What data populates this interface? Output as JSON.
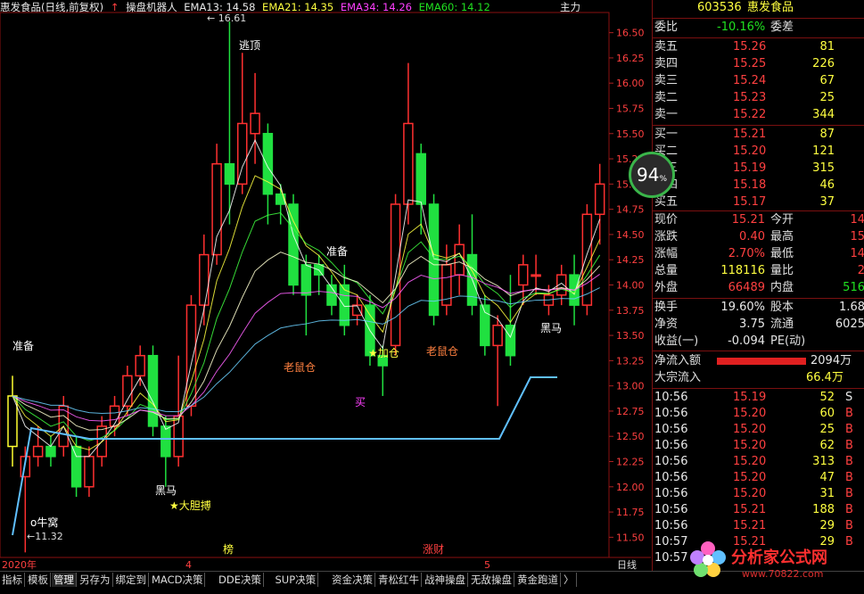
{
  "header": {
    "title": "惠发食品(日线,前复权)",
    "robot": "操盘机器人",
    "ema13": "EMA13: 14.58",
    "ema21": "EMA21: 14.35",
    "ema34": "EMA34: 14.26",
    "ema60": "EMA60: 14.12",
    "right_label": "主力"
  },
  "chart": {
    "y_ticks": [
      "16.50",
      "16.25",
      "16.00",
      "15.75",
      "15.50",
      "15.25",
      "15.00",
      "14.75",
      "14.50",
      "14.25",
      "14.00",
      "13.75",
      "13.50",
      "13.25",
      "13.00",
      "12.75",
      "12.50",
      "12.25",
      "12.00",
      "11.75",
      "11.50"
    ],
    "x_labels": [
      "2020年",
      "4",
      "5",
      "日线"
    ],
    "high_label": "16.61",
    "low_label": "11.32",
    "annotations": [
      {
        "text": "逃顶",
        "color": "#ffffff"
      },
      {
        "text": "准备",
        "color": "#ffffff"
      },
      {
        "text": "准备",
        "color": "#ffffff"
      },
      {
        "text": "老鼠仓",
        "color": "#ff8040"
      },
      {
        "text": "老鼠仓",
        "color": "#ff8040"
      },
      {
        "text": "★加仓",
        "color": "#ffff40"
      },
      {
        "text": "买",
        "color": "#ff40ff"
      },
      {
        "text": "黑马",
        "color": "#ffffff"
      },
      {
        "text": "黑马",
        "color": "#ffffff"
      },
      {
        "text": "★大胆搏",
        "color": "#ffff40"
      },
      {
        "text": "o牛窝",
        "color": "#ffffff"
      },
      {
        "text": "榜",
        "color": "#ffff40"
      },
      {
        "text": "涨财",
        "color": "#ff4040"
      }
    ]
  },
  "chart_data": {
    "type": "candlestick",
    "ylim": [
      11.3,
      16.7
    ],
    "candles": [
      [
        12.4,
        12.9,
        12.2,
        13.1
      ],
      [
        12.1,
        12.3,
        11.35,
        12.4
      ],
      [
        12.3,
        12.4,
        12.2,
        12.6
      ],
      [
        12.4,
        12.3,
        12.2,
        12.5
      ],
      [
        12.4,
        12.8,
        12.3,
        12.9
      ],
      [
        12.4,
        12.0,
        11.9,
        12.5
      ],
      [
        12.0,
        12.3,
        11.9,
        12.4
      ],
      [
        12.3,
        12.6,
        12.2,
        12.7
      ],
      [
        12.6,
        12.8,
        12.5,
        12.9
      ],
      [
        12.8,
        13.1,
        12.7,
        13.2
      ],
      [
        13.1,
        13.3,
        13.0,
        13.4
      ],
      [
        13.3,
        12.6,
        12.5,
        13.4
      ],
      [
        12.6,
        12.3,
        12.0,
        12.7
      ],
      [
        12.3,
        12.7,
        12.2,
        13.3
      ],
      [
        12.8,
        13.8,
        12.7,
        13.9
      ],
      [
        13.8,
        14.3,
        13.6,
        14.5
      ],
      [
        14.3,
        15.2,
        14.2,
        15.4
      ],
      [
        15.2,
        15.0,
        14.6,
        16.61
      ],
      [
        15.0,
        15.6,
        14.9,
        16.3
      ],
      [
        15.5,
        15.7,
        15.2,
        16.1
      ],
      [
        15.5,
        14.9,
        14.6,
        15.6
      ],
      [
        14.9,
        14.8,
        14.6,
        15.0
      ],
      [
        14.8,
        14.0,
        13.9,
        14.9
      ],
      [
        14.2,
        13.9,
        13.5,
        14.3
      ],
      [
        14.2,
        14.1,
        13.9,
        14.3
      ],
      [
        14.0,
        13.8,
        13.7,
        14.1
      ],
      [
        14.0,
        13.6,
        13.5,
        14.2
      ],
      [
        13.7,
        13.8,
        13.6,
        13.9
      ],
      [
        13.8,
        13.3,
        13.2,
        13.9
      ],
      [
        13.3,
        13.2,
        12.9,
        13.4
      ],
      [
        13.4,
        14.8,
        13.3,
        14.9
      ],
      [
        14.8,
        15.6,
        14.6,
        16.2
      ],
      [
        15.3,
        14.8,
        14.5,
        15.4
      ],
      [
        14.8,
        13.7,
        13.6,
        14.9
      ],
      [
        13.8,
        14.2,
        13.7,
        14.4
      ],
      [
        14.1,
        14.4,
        13.9,
        14.6
      ],
      [
        14.3,
        13.8,
        13.7,
        14.7
      ],
      [
        13.8,
        13.4,
        13.3,
        13.9
      ],
      [
        13.4,
        13.6,
        12.8,
        13.7
      ],
      [
        13.6,
        13.3,
        13.2,
        14.1
      ],
      [
        14.0,
        14.2,
        13.8,
        14.3
      ],
      [
        14.1,
        14.1,
        13.9,
        14.3
      ],
      [
        13.8,
        13.9,
        13.7,
        14.0
      ],
      [
        13.9,
        14.1,
        13.8,
        14.2
      ],
      [
        14.1,
        13.8,
        13.6,
        14.3
      ],
      [
        13.8,
        14.7,
        13.7,
        14.8
      ],
      [
        14.7,
        15.0,
        14.4,
        15.2
      ]
    ]
  },
  "quote": {
    "code": "603536",
    "name": "惠发食品",
    "weibi_label": "委比",
    "weibi": "-10.16%",
    "weicha_label": "委差",
    "asks": [
      {
        "label": "卖五",
        "price": "15.26",
        "vol": "81"
      },
      {
        "label": "卖四",
        "price": "15.25",
        "vol": "226"
      },
      {
        "label": "卖三",
        "price": "15.24",
        "vol": "67"
      },
      {
        "label": "卖二",
        "price": "15.23",
        "vol": "25"
      },
      {
        "label": "卖一",
        "price": "15.22",
        "vol": "344"
      }
    ],
    "bids": [
      {
        "label": "买一",
        "price": "15.21",
        "vol": "87"
      },
      {
        "label": "买二",
        "price": "15.20",
        "vol": "121"
      },
      {
        "label": "买三",
        "price": "15.19",
        "vol": "315"
      },
      {
        "label": "买四",
        "price": "15.18",
        "vol": "46"
      },
      {
        "label": "买五",
        "price": "15.17",
        "vol": "37"
      }
    ],
    "stats": [
      {
        "l1": "现价",
        "v1": "15.21",
        "l2": "今开",
        "v2": "14",
        "c1": "red",
        "c2": "red"
      },
      {
        "l1": "涨跌",
        "v1": "0.40",
        "l2": "最高",
        "v2": "15",
        "c1": "red",
        "c2": "red"
      },
      {
        "l1": "涨幅",
        "v1": "2.70%",
        "l2": "最低",
        "v2": "14",
        "c1": "red",
        "c2": "red"
      },
      {
        "l1": "总量",
        "v1": "118116",
        "l2": "量比",
        "v2": "2",
        "c1": "yel",
        "c2": "red"
      },
      {
        "l1": "外盘",
        "v1": "66489",
        "l2": "内盘",
        "v2": "516",
        "c1": "red",
        "c2": "grn"
      }
    ],
    "stats2": [
      {
        "l1": "换手",
        "v1": "19.60%",
        "l2": "股本",
        "v2": "1.68"
      },
      {
        "l1": "净资",
        "v1": "3.75",
        "l2": "流通",
        "v2": "6025"
      },
      {
        "l1": "收益(一)",
        "v1": "-0.094",
        "l2": "PE(动)",
        "v2": ""
      }
    ],
    "inflow_label": "净流入额",
    "inflow_value": "2094万",
    "block_label": "大宗流入",
    "block_value": "66.4万",
    "ticks": [
      {
        "time": "10:56",
        "price": "15.19",
        "vol": "52",
        "side": "S"
      },
      {
        "time": "10:56",
        "price": "15.20",
        "vol": "60",
        "side": "B"
      },
      {
        "time": "10:56",
        "price": "15.20",
        "vol": "25",
        "side": "B"
      },
      {
        "time": "10:56",
        "price": "15.20",
        "vol": "62",
        "side": "B"
      },
      {
        "time": "10:56",
        "price": "15.20",
        "vol": "313",
        "side": "B"
      },
      {
        "time": "10:56",
        "price": "15.20",
        "vol": "47",
        "side": "B"
      },
      {
        "time": "10:56",
        "price": "15.20",
        "vol": "31",
        "side": "B"
      },
      {
        "time": "10:56",
        "price": "15.21",
        "vol": "188",
        "side": "B"
      },
      {
        "time": "10:56",
        "price": "15.21",
        "vol": "29",
        "side": "B"
      },
      {
        "time": "10:57",
        "price": "15.21",
        "vol": "29",
        "side": "B"
      },
      {
        "time": "10:57",
        "price": "",
        "vol": "",
        "side": ""
      }
    ],
    "gauge": "94",
    "gauge_unit": "%"
  },
  "tabs": [
    "指标",
    "模板",
    "管理",
    "另存为",
    "绑定到",
    "MACD决策",
    "DDE决策",
    "SUP决策",
    "资金决策",
    "青松红牛",
    "战神操盘",
    "无敌操盘",
    "黄金跑道",
    "〉"
  ],
  "watermark": {
    "name": "分析家公式网",
    "url": "www.70822.com"
  }
}
